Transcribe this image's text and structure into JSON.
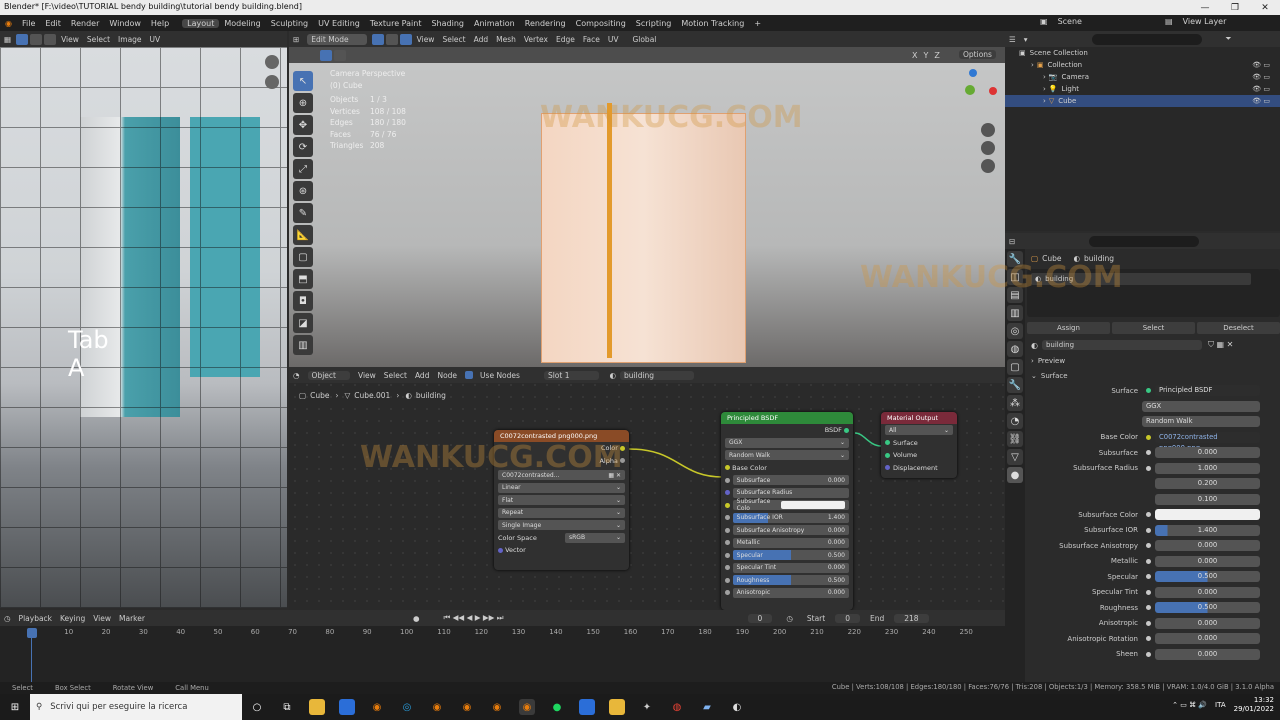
{
  "titlebar": {
    "title": "Blender* [F:\\video\\TUTORIAL bendy building\\tutorial bendy building.blend]"
  },
  "menu": {
    "items": [
      "File",
      "Edit",
      "Render",
      "Window",
      "Help"
    ],
    "workspaces": [
      "Layout",
      "Modeling",
      "Sculpting",
      "UV Editing",
      "Texture Paint",
      "Shading",
      "Animation",
      "Rendering",
      "Compositing",
      "Scripting",
      "Motion Tracking"
    ],
    "active_workspace": "Layout",
    "scene": "Scene",
    "view_layer": "View Layer"
  },
  "image_editor": {
    "menu": [
      "View",
      "Select",
      "Image",
      "UV"
    ],
    "overlay_text": "Tab\nA"
  },
  "viewport": {
    "mode": "Edit Mode",
    "menu": [
      "View",
      "Select",
      "Add",
      "Mesh",
      "Vertex",
      "Edge",
      "Face",
      "UV"
    ],
    "orientation": "Global",
    "options": "Options",
    "axes": [
      "X",
      "Y",
      "Z"
    ],
    "info": {
      "view": "Camera Perspective",
      "object": "(0) Cube",
      "stats": [
        {
          "label": "Objects",
          "value": "1 / 3"
        },
        {
          "label": "Vertices",
          "value": "108 / 108"
        },
        {
          "label": "Edges",
          "value": "180 / 180"
        },
        {
          "label": "Faces",
          "value": "76 / 76"
        },
        {
          "label": "Triangles",
          "value": "208"
        }
      ]
    }
  },
  "node_editor": {
    "type": "Object",
    "menu": [
      "View",
      "Select",
      "Add",
      "Node"
    ],
    "use_nodes": "Use Nodes",
    "slot": "Slot 1",
    "material": "building",
    "breadcrumb": [
      "Cube",
      "Cube.001",
      "building"
    ],
    "image_node": {
      "title": "C0072contrasted png000.png",
      "outputs": [
        "Color",
        "Alpha"
      ],
      "image": "C0072contrasted...",
      "interp": "Linear",
      "projection": "Flat",
      "extension": "Repeat",
      "source": "Single Image",
      "colorspace_label": "Color Space",
      "colorspace": "sRGB",
      "input": "Vector"
    },
    "bsdf_node": {
      "title": "Principled BSDF",
      "output": "BSDF",
      "dist": "GGX",
      "sss": "Random Walk",
      "base": "Base Color",
      "fields": [
        {
          "l": "Subsurface",
          "v": "0.000",
          "p": 0
        },
        {
          "l": "Subsurface Radius",
          "v": "",
          "p": 0
        },
        {
          "l": "Subsurface Colo",
          "v": "",
          "p": 0
        },
        {
          "l": "Subsurface IOR",
          "v": "1.400",
          "p": 30
        },
        {
          "l": "Subsurface Anisotropy",
          "v": "0.000",
          "p": 0
        },
        {
          "l": "Metallic",
          "v": "0.000",
          "p": 0
        },
        {
          "l": "Specular",
          "v": "0.500",
          "p": 50
        },
        {
          "l": "Specular Tint",
          "v": "0.000",
          "p": 0
        },
        {
          "l": "Roughness",
          "v": "0.500",
          "p": 50
        },
        {
          "l": "Anisotropic",
          "v": "0.000",
          "p": 0
        }
      ]
    },
    "output_node": {
      "title": "Material Output",
      "target": "All",
      "inputs": [
        "Surface",
        "Volume",
        "Displacement"
      ]
    }
  },
  "outliner": {
    "root": "Scene Collection",
    "items": [
      {
        "name": "Collection",
        "indent": 1
      },
      {
        "name": "Camera",
        "indent": 2
      },
      {
        "name": "Light",
        "indent": 2
      },
      {
        "name": "Cube",
        "indent": 2,
        "selected": true
      }
    ]
  },
  "properties": {
    "object": "Cube",
    "material": "building",
    "slot": "building",
    "buttons": [
      "Assign",
      "Select",
      "Deselect"
    ],
    "material_name": "building",
    "preview": "Preview",
    "surface_section": "Surface",
    "surface_label": "Surface",
    "surface_value": "Principled BSDF",
    "dist": "GGX",
    "sss": "Random Walk",
    "base_color_label": "Base Color",
    "base_color_value": "C0072contrasted png000.png",
    "rows": [
      {
        "l": "Subsurface",
        "v": "0.000",
        "t": "n",
        "p": 0
      },
      {
        "l": "Subsurface Radius",
        "v": "1.000",
        "t": "n",
        "p": 0
      },
      {
        "l": "",
        "v": "0.200",
        "t": "n",
        "p": 0
      },
      {
        "l": "",
        "v": "0.100",
        "t": "n",
        "p": 0
      },
      {
        "l": "Subsurface Color",
        "v": "",
        "t": "w",
        "p": 0
      },
      {
        "l": "Subsurface IOR",
        "v": "1.400",
        "t": "b",
        "p": 12
      },
      {
        "l": "Subsurface Anisotropy",
        "v": "0.000",
        "t": "n",
        "p": 0
      },
      {
        "l": "Metallic",
        "v": "0.000",
        "t": "n",
        "p": 0
      },
      {
        "l": "Specular",
        "v": "0.500",
        "t": "b",
        "p": 50
      },
      {
        "l": "Specular Tint",
        "v": "0.000",
        "t": "n",
        "p": 0
      },
      {
        "l": "Roughness",
        "v": "0.500",
        "t": "b",
        "p": 50
      },
      {
        "l": "Anisotropic",
        "v": "0.000",
        "t": "n",
        "p": 0
      },
      {
        "l": "Anisotropic Rotation",
        "v": "0.000",
        "t": "n",
        "p": 0
      },
      {
        "l": "Sheen",
        "v": "0.000",
        "t": "n",
        "p": 0
      }
    ]
  },
  "timeline": {
    "menu": [
      "Playback",
      "Keying",
      "View",
      "Marker"
    ],
    "current": "0",
    "start_label": "Start",
    "start": "0",
    "end_label": "End",
    "end": "218",
    "ticks": [
      "0",
      "10",
      "20",
      "30",
      "40",
      "50",
      "60",
      "70",
      "80",
      "90",
      "100",
      "110",
      "120",
      "130",
      "140",
      "150",
      "160",
      "170",
      "180",
      "190",
      "200",
      "210",
      "220",
      "230",
      "240",
      "250"
    ]
  },
  "status": {
    "left": [
      "Select",
      "Box Select",
      "Rotate View",
      "Call Menu"
    ],
    "right": "Cube | Verts:108/108 | Edges:180/180 | Faces:76/76 | Tris:208 | Objects:1/3 | Memory: 358.5 MiB | VRAM: 1.0/4.0 GiB | 3.1.0 Alpha"
  },
  "taskbar": {
    "search": "Scrivi qui per eseguire la ricerca",
    "lang": "ITA",
    "time": "13:32",
    "date": "29/01/2022"
  },
  "watermark": "WANKUCG.COM"
}
